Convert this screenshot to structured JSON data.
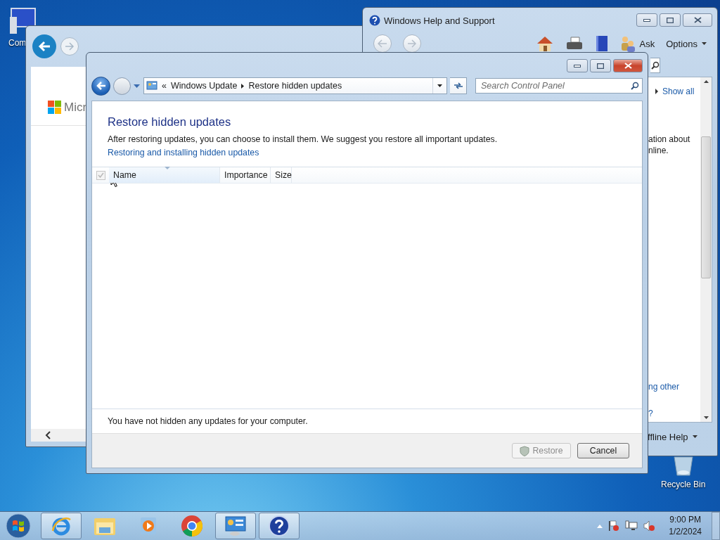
{
  "desktop_icons": [
    {
      "kind": "computer",
      "label": "Com"
    },
    {
      "kind": "recycle",
      "label": "Recycle Bin"
    }
  ],
  "browser_window": {
    "logo_text": "Micr"
  },
  "help_window": {
    "title": "Windows Help and Support",
    "ask": "Ask",
    "options": "Options",
    "fragments": [
      {
        "kind": "link",
        "text": "Show all"
      },
      {
        "kind": "text",
        "text": "ation about"
      },
      {
        "kind": "text",
        "text": "nline."
      },
      {
        "kind": "link",
        "text": "ng other"
      },
      {
        "kind": "link",
        "text": "?"
      }
    ],
    "footer": "ffline Help"
  },
  "main_window": {
    "breadcrumb": {
      "overflow": "«",
      "items": [
        "Windows Update",
        "Restore hidden updates"
      ]
    },
    "search": {
      "placeholder": "Search Control Panel"
    },
    "heading": "Restore hidden updates",
    "description": "After restoring updates, you can choose to install them. We suggest you restore all important updates.",
    "link": "Restoring and installing hidden updates",
    "select_all": {
      "checked": true,
      "disabled": true
    },
    "columns": [
      {
        "label": "Name",
        "sorted": true
      },
      {
        "label": "Importance",
        "sorted": false
      },
      {
        "label": "Size",
        "sorted": false
      }
    ],
    "status": "You have not hidden any updates for your computer.",
    "buttons": [
      {
        "kind": "shield",
        "label": "Restore",
        "disabled": true
      },
      {
        "kind": "plain",
        "label": "Cancel",
        "disabled": false
      }
    ]
  },
  "taskbar": {
    "apps": [
      {
        "kind": "ie",
        "running": true
      },
      {
        "kind": "explorer",
        "running": false
      },
      {
        "kind": "media",
        "running": false
      },
      {
        "kind": "chrome",
        "running": false
      },
      {
        "kind": "control",
        "running": true
      },
      {
        "kind": "help",
        "running": true
      }
    ],
    "clock": {
      "time": "9:00 PM",
      "date": "1/2/2024"
    }
  }
}
